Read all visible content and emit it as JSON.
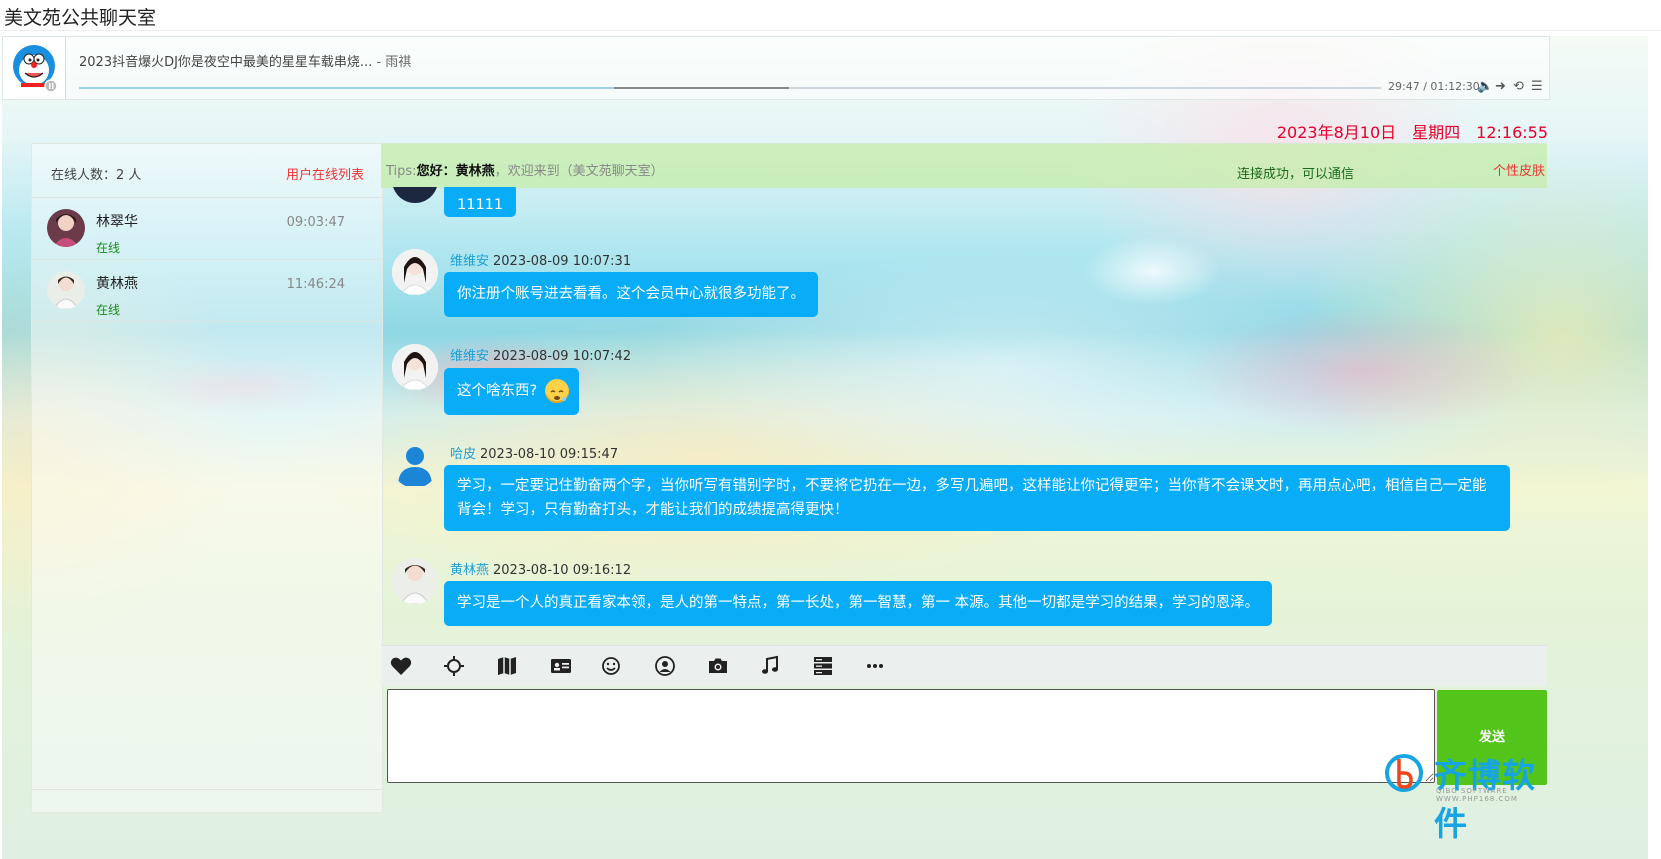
{
  "window": {
    "title": "美文苑公共聊天室"
  },
  "player": {
    "song": "2023抖音爆火DJ你是夜空中最美的星星车载串烧...",
    "artist": " - 雨祺",
    "time": "29:47 / 01:12:30",
    "progress": 0.41
  },
  "datetime": {
    "date": "2023年8月10日",
    "weekday": "星期四",
    "time": "12:16:55"
  },
  "online": {
    "count_label": "在线人数：2 人",
    "list_link": "用户在线列表",
    "users": [
      {
        "name": "林翠华",
        "status": "在线",
        "time": "09:03:47"
      },
      {
        "name": "黄林燕",
        "status": "在线",
        "time": "11:46:24"
      }
    ]
  },
  "tips": {
    "prefix": "Tips:",
    "greeting": "您好：",
    "user": "黄林燕",
    "welcome": "，欢迎来到（美文苑聊天室）",
    "connection": "连接成功，可以通信",
    "skin": "个性皮肤"
  },
  "messages": [
    {
      "name": "",
      "date": "",
      "text": "11111"
    },
    {
      "name": "维维安",
      "date": "2023-08-09 10:07:31",
      "text": "你注册个账号进去看看。这个会员中心就很多功能了。"
    },
    {
      "name": "维维安",
      "date": "2023-08-09 10:07:42",
      "text": "这个啥东西?"
    },
    {
      "name": "哈皮",
      "date": "2023-08-10 09:15:47",
      "text": "学习，一定要记住勤奋两个字，当你听写有错别字时，不要将它扔在一边，多写几遍吧，这样能让你记得更牢；当你背不会课文时，再用点心吧，相信自己一定能背会！学习，只有勤奋打头，才能让我们的成绩提高得更快！"
    },
    {
      "name": "黄林燕",
      "date": "2023-08-10 09:16:12",
      "text": "学习是一个人的真正看家本领，是人的第一特点，第一长处，第一智慧，第一 本源。其他一切都是学习的结果，学习的恩泽。"
    }
  ],
  "toolbar": {
    "icons": [
      "heart-icon",
      "sun-icon",
      "map-icon",
      "id-card-icon",
      "smile-icon",
      "user-circle-icon",
      "camera-icon",
      "music-icon",
      "server-icon",
      "more-icon"
    ]
  },
  "input": {
    "value": "",
    "send_label": "发送"
  },
  "watermark": {
    "brand": "齐博软件",
    "sub": "QIBO SOFTWARE   WWW.PHP168.COM"
  },
  "colors": {
    "bubble": "#09acf6",
    "send": "#52c41a",
    "accent_red": "#e4002b",
    "name_blue": "#1c9fd8"
  }
}
